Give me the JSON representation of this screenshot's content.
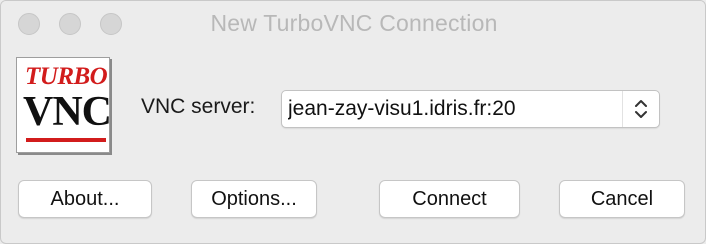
{
  "window": {
    "title": "New TurboVNC Connection"
  },
  "logo": {
    "line1": "TURBO",
    "line2": "VNC",
    "accent_color": "#d21c1c"
  },
  "server": {
    "label": "VNC server:",
    "value": "jean-zay-visu1.idris.fr:20"
  },
  "buttons": {
    "about": "About...",
    "options": "Options...",
    "connect": "Connect",
    "cancel": "Cancel"
  }
}
